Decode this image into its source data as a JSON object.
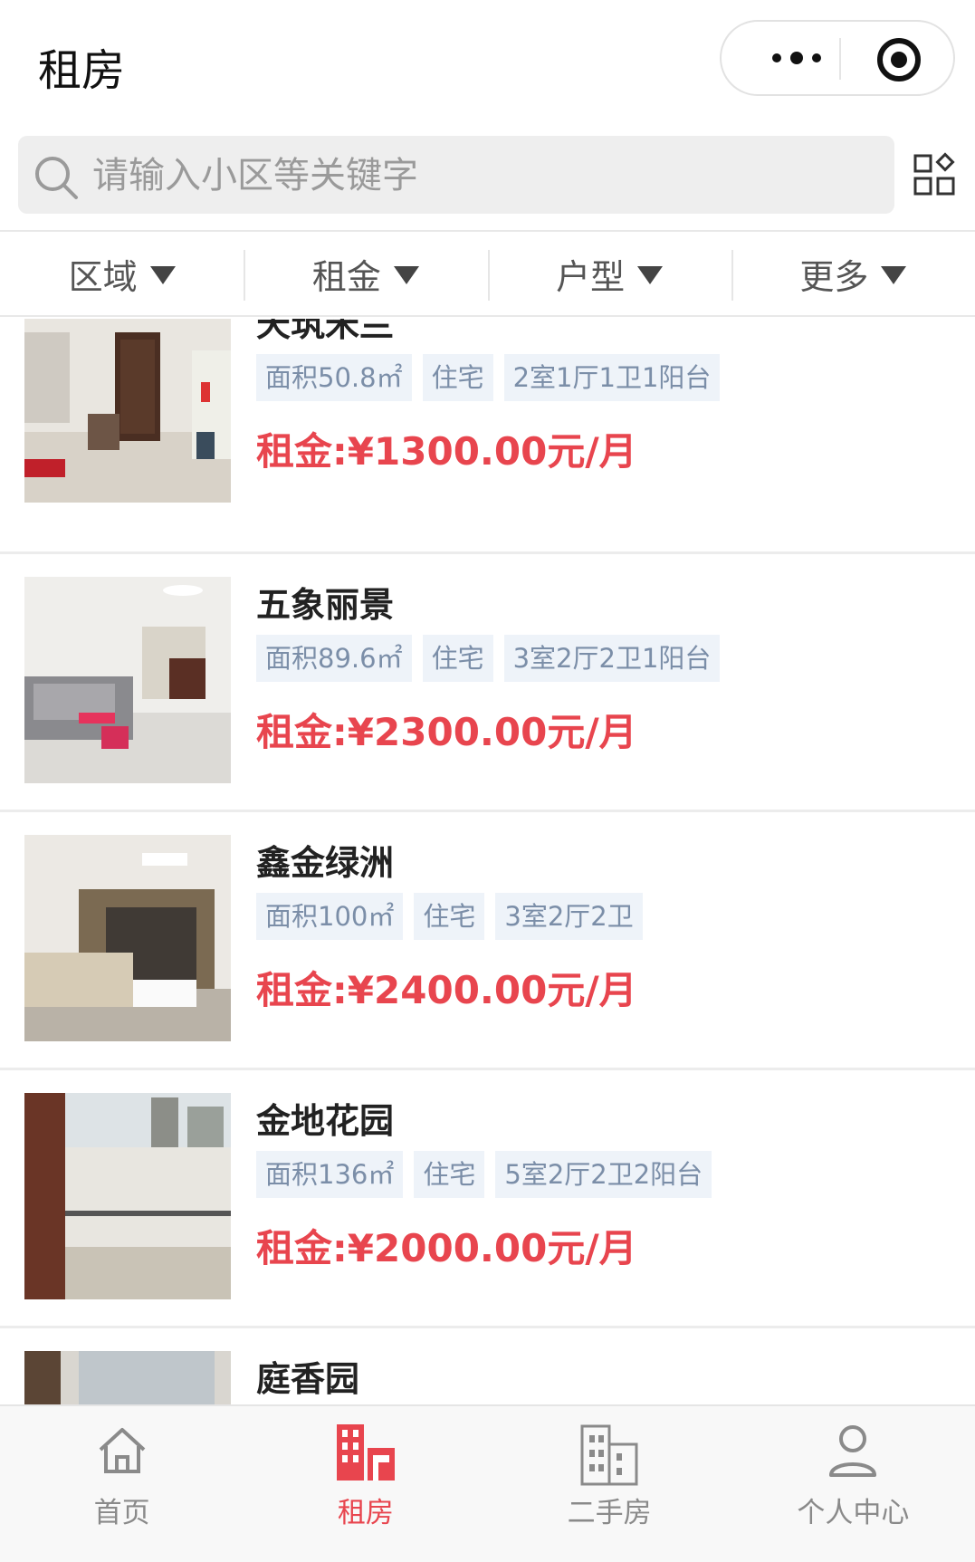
{
  "header": {
    "title": "租房"
  },
  "search": {
    "placeholder": "请输入小区等关键字"
  },
  "filters": [
    {
      "label": "区域"
    },
    {
      "label": "租金"
    },
    {
      "label": "户型"
    },
    {
      "label": "更多"
    }
  ],
  "listings": [
    {
      "name": "天筑米兰",
      "area": "面积50.8㎡",
      "type": "住宅",
      "layout": "2室1厅1卫1阳台",
      "price": "租金:¥1300.00元/月"
    },
    {
      "name": "五象丽景",
      "area": "面积89.6㎡",
      "type": "住宅",
      "layout": "3室2厅2卫1阳台",
      "price": "租金:¥2300.00元/月"
    },
    {
      "name": "鑫金绿洲",
      "area": "面积100㎡",
      "type": "住宅",
      "layout": "3室2厅2卫",
      "price": "租金:¥2400.00元/月"
    },
    {
      "name": "金地花园",
      "area": "面积136㎡",
      "type": "住宅",
      "layout": "5室2厅2卫2阳台",
      "price": "租金:¥2000.00元/月"
    },
    {
      "name": "庭香园"
    }
  ],
  "tabbar": {
    "items": [
      {
        "label": "首页",
        "icon": "home-icon"
      },
      {
        "label": "租房",
        "icon": "rent-building-icon",
        "active": true
      },
      {
        "label": "二手房",
        "icon": "building-icon"
      },
      {
        "label": "个人中心",
        "icon": "person-icon"
      }
    ],
    "active_color": "#e8454e",
    "inactive_color": "#8a8a8a"
  },
  "colors": {
    "price": "#e8454e",
    "tag_bg": "#eef3f9",
    "tag_text": "#7b8ea8"
  }
}
